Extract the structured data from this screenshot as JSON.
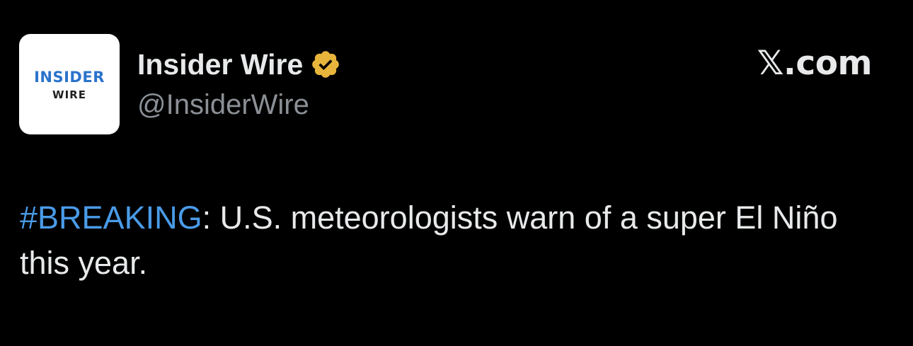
{
  "account": {
    "avatar_text_line1": "INSIDER",
    "avatar_text_line2": "WIRE",
    "display_name": "Insider Wire",
    "handle": "@InsiderWire",
    "verified_icon": "verified-badge-icon",
    "verified_color": "#e8b53c"
  },
  "brand": {
    "label": "𝕏.com"
  },
  "tweet": {
    "hashtag": "#BREAKING",
    "text": ": U.S. meteorologists warn of a super El Niño this year."
  },
  "colors": {
    "background": "#000000",
    "text": "#e7e9ea",
    "muted": "#8b9096",
    "link": "#4a9be8",
    "avatar_accent": "#2a73cc"
  }
}
